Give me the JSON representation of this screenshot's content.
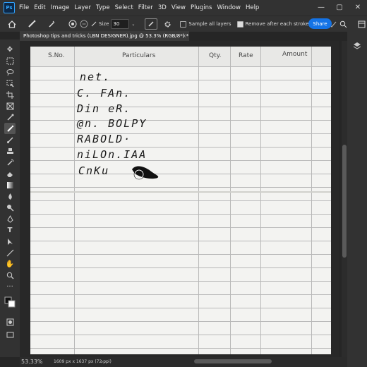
{
  "menubar": {
    "logo": "Ps",
    "items": [
      "File",
      "Edit",
      "Image",
      "Layer",
      "Type",
      "Select",
      "Filter",
      "3D",
      "View",
      "Plugins",
      "Window",
      "Help"
    ],
    "window_controls": [
      "—",
      "▢",
      "✕"
    ]
  },
  "options": {
    "size_label": "Size",
    "size_value": "30",
    "sample_all_layers": "Sample all layers",
    "remove_after_stroke": "Remove after each stroke",
    "share_label": "Share"
  },
  "document": {
    "tab_title": "Photoshop tips and tricks (LBN DESIGNER).jpg @ 53.3% (RGB/8*) *",
    "close": "×"
  },
  "paper": {
    "headers": {
      "sno": "S.No.",
      "particulars": "Particulars",
      "qty": "Qty.",
      "rate": "Rate",
      "amount": "Amount"
    },
    "handwritten": [
      "net.",
      "C. FAn.",
      "Din eR.",
      "@n. BOLPY",
      "RABOLD·",
      "niLOn.IAA",
      "CnKu"
    ]
  },
  "status": {
    "zoom": "53.33%",
    "info": "1609 px x 1637 px (72 ppi)"
  },
  "colors": {
    "accent": "#1473e6",
    "chrome": "#323232",
    "canvas_bg": "#282828"
  }
}
